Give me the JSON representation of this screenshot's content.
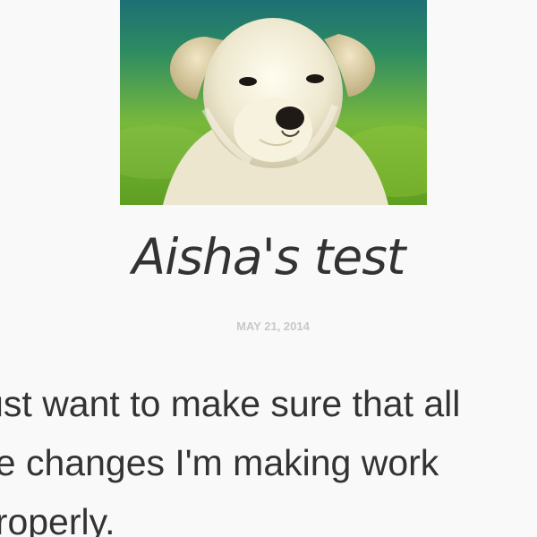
{
  "post": {
    "image_alt": "puppy-photo",
    "title": "Aisha's test",
    "date": "MAY 21, 2014",
    "body_lines": [
      "just want to make sure that all",
      "he changes I'm making work",
      "properly."
    ]
  },
  "colors": {
    "background": "#f9f9f9",
    "title": "#333333",
    "date": "#c8c8c8",
    "body": "#333333"
  }
}
